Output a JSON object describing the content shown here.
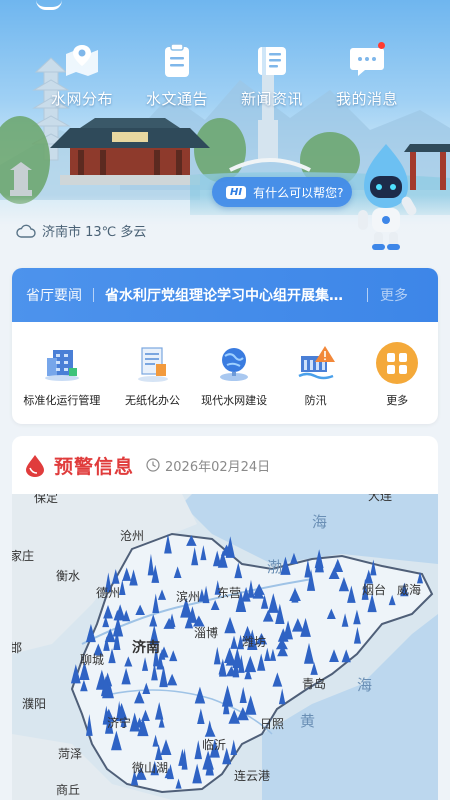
{
  "quick_nav": [
    {
      "label": "水网分布",
      "icon": "map-pin-icon"
    },
    {
      "label": "水文通告",
      "icon": "clipboard-icon"
    },
    {
      "label": "新闻资讯",
      "icon": "news-icon"
    },
    {
      "label": "我的消息",
      "icon": "chat-message-icon",
      "has_unread": true
    }
  ],
  "assistant": {
    "badge": "HI",
    "prompt": "有什么可以帮您?"
  },
  "weather": {
    "text": "济南市 13℃ 多云",
    "icon": "cloud-icon"
  },
  "news": {
    "tag": "省厅要闻",
    "headline": "省水利厅党组理论学习中心组开展集…",
    "more": "更多"
  },
  "functions": [
    {
      "label": "标准化运行管理",
      "icon": "building-icon"
    },
    {
      "label": "无纸化办公",
      "icon": "document-icon"
    },
    {
      "label": "现代水网建设",
      "icon": "globe-icon"
    },
    {
      "label": "防汛",
      "icon": "dam-warning-icon"
    },
    {
      "label": "更多",
      "icon": "grid-icon"
    }
  ],
  "warning": {
    "title": "预警信息",
    "date": "2026年02月24日",
    "icon": "water-drop-icon"
  },
  "map_labels": {
    "baoding": "保定",
    "dalian": "大连",
    "cangzhou": "沧州",
    "jiazhuang": "家庄",
    "hengshui": "衡水",
    "hai1": "海",
    "bo": "渤",
    "dezhou": "德州",
    "binzhou": "滨州",
    "dongying": "东营",
    "yantai": "烟台",
    "weihai": "威海",
    "zibo": "淄博",
    "weifang": "潍坊",
    "handan": "邯",
    "jinan": "济南",
    "liaocheng": "聊城",
    "qingdao": "青岛",
    "hai2": "海",
    "puyang": "濮阳",
    "jining": "济宁",
    "rizhao": "日照",
    "huang": "黄",
    "linyi": "临沂",
    "heze": "菏泽",
    "weishan": "微山湖",
    "lianyungang": "连云港",
    "shangqiu": "商丘"
  },
  "colors": {
    "accent": "#3d86e8",
    "warning_red": "#e03c3c",
    "marker": "#2f63c4"
  }
}
